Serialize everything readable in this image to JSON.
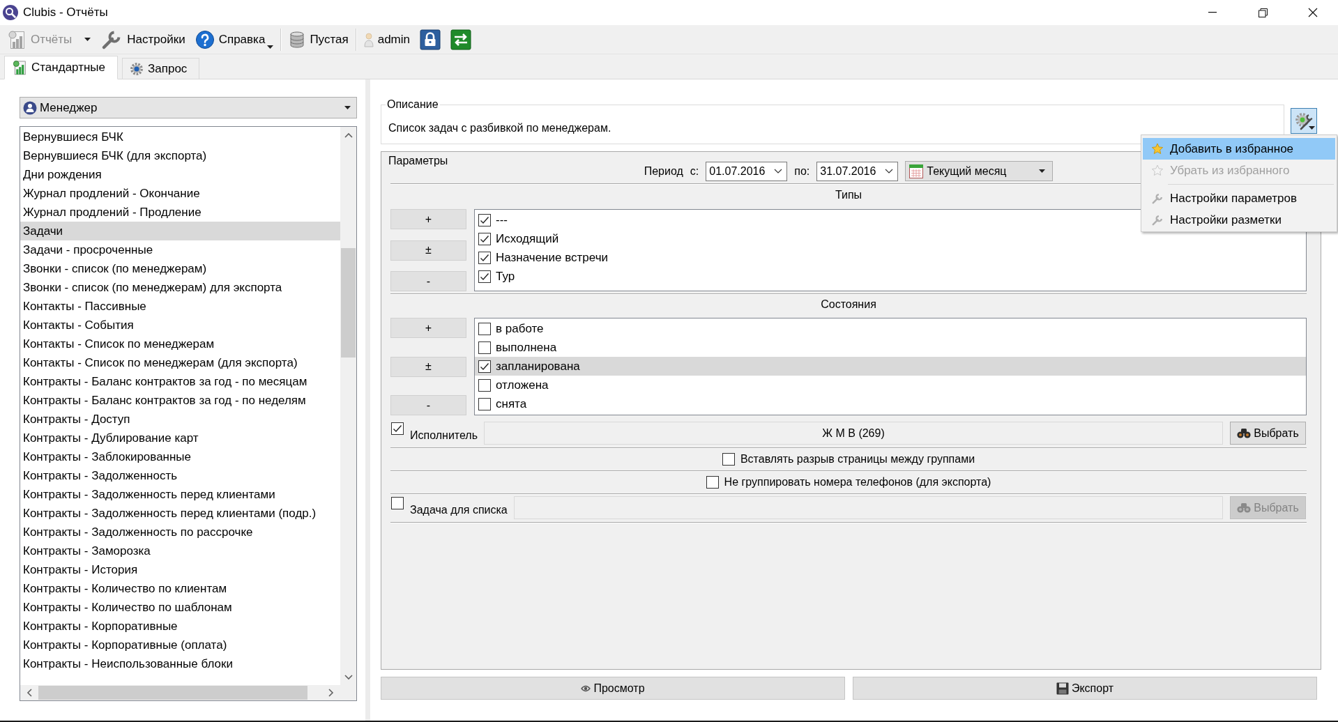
{
  "window": {
    "title": "Clubis - Отчёты"
  },
  "toolbar": {
    "groups": [
      [
        {
          "kind": "reports",
          "label": "Отчёты",
          "disabled": true,
          "split": true,
          "menu": false
        },
        {
          "kind": "wrench",
          "label": "Настройки",
          "disabled": false,
          "split": false,
          "menu": false
        },
        {
          "kind": "help",
          "label": "Справка",
          "disabled": false,
          "split": false,
          "menu": true
        }
      ],
      [
        {
          "kind": "database",
          "label": "Пустая",
          "disabled": false,
          "split": false,
          "menu": false
        }
      ],
      [
        {
          "kind": "user",
          "label": "admin",
          "disabled": false,
          "split": false,
          "menu": false
        },
        {
          "kind": "lock",
          "disabled": false,
          "split": false,
          "menu": false
        },
        {
          "kind": "exchange",
          "disabled": false,
          "split": false,
          "menu": false
        }
      ]
    ]
  },
  "tabs": [
    {
      "kind": "chart",
      "label": "Стандартные",
      "selected": true
    },
    {
      "kind": "gear",
      "label": "Запрос",
      "selected": false
    }
  ],
  "report_group": {
    "value": "Менеджер"
  },
  "reports": [
    {
      "label": "Вернувшиеся БЧК",
      "selected": false
    },
    {
      "label": "Вернувшиеся БЧК (для экспорта)",
      "selected": false
    },
    {
      "label": "Дни рождения",
      "selected": false
    },
    {
      "label": "Журнал продлений - Окончание",
      "selected": false
    },
    {
      "label": "Журнал продлений - Продление",
      "selected": false
    },
    {
      "label": "Задачи",
      "selected": true
    },
    {
      "label": "Задачи - просроченные",
      "selected": false
    },
    {
      "label": "Звонки - список (по менеджерам)",
      "selected": false
    },
    {
      "label": "Звонки - список (по менеджерам) для экспорта",
      "selected": false
    },
    {
      "label": "Контакты - Пассивные",
      "selected": false
    },
    {
      "label": "Контакты - События",
      "selected": false
    },
    {
      "label": "Контакты - Список по менеджерам",
      "selected": false
    },
    {
      "label": "Контакты - Список по менеджерам (для экспорта)",
      "selected": false
    },
    {
      "label": "Контракты - Баланс контрактов за год - по месяцам",
      "selected": false
    },
    {
      "label": "Контракты - Баланс контрактов за год - по неделям",
      "selected": false
    },
    {
      "label": "Контракты - Доступ",
      "selected": false
    },
    {
      "label": "Контракты - Дублирование карт",
      "selected": false
    },
    {
      "label": "Контракты - Заблокированные",
      "selected": false
    },
    {
      "label": "Контракты - Задолженность",
      "selected": false
    },
    {
      "label": "Контракты - Задолженность перед клиентами",
      "selected": false
    },
    {
      "label": "Контракты - Задолженность перед клиентами (подр.)",
      "selected": false
    },
    {
      "label": "Контракты - Задолженность по рассрочке",
      "selected": false
    },
    {
      "label": "Контракты - Заморозка",
      "selected": false
    },
    {
      "label": "Контракты - История",
      "selected": false
    },
    {
      "label": "Контракты - Количество по клиентам",
      "selected": false
    },
    {
      "label": "Контракты - Количество по шаблонам",
      "selected": false
    },
    {
      "label": "Контракты - Корпоративные",
      "selected": false
    },
    {
      "label": "Контракты - Корпоративные (оплата)",
      "selected": false
    },
    {
      "label": "Контракты - Неиспользованные блоки",
      "selected": false
    }
  ],
  "description": {
    "title": "Описание",
    "text": "Список задач с разбивкой по менеджерам."
  },
  "parameters": {
    "title": "Параметры",
    "period": {
      "label": "Период",
      "from_label": "с:",
      "from": "01.07.2016",
      "to_label": "по:",
      "to": "31.07.2016",
      "preset": "Текущий месяц"
    },
    "lists": [
      {
        "title": "Типы",
        "buttons": [
          "+",
          "±",
          "-"
        ],
        "items": [
          {
            "label": "---",
            "checked": true,
            "selected": false
          },
          {
            "label": "Исходящий",
            "checked": true,
            "selected": false
          },
          {
            "label": "Назначение встречи",
            "checked": true,
            "selected": false
          },
          {
            "label": "Тур",
            "checked": true,
            "selected": false
          }
        ]
      },
      {
        "title": "Состояния",
        "buttons": [
          "+",
          "±",
          "-"
        ],
        "items": [
          {
            "label": "в работе",
            "checked": false,
            "selected": false
          },
          {
            "label": "выполнена",
            "checked": false,
            "selected": false
          },
          {
            "label": "запланирована",
            "checked": true,
            "selected": true
          },
          {
            "label": "отложена",
            "checked": false,
            "selected": false
          },
          {
            "label": "снята",
            "checked": false,
            "selected": false
          }
        ]
      }
    ],
    "rows": [
      {
        "kind": "picker",
        "checked": true,
        "label": "Исполнитель",
        "value": "Ж М В (269)",
        "button": "Выбрать",
        "disabled": false
      },
      {
        "kind": "option",
        "checked": false,
        "label": "Вставлять разрыв страницы между группами"
      },
      {
        "kind": "option",
        "checked": false,
        "label": "Не группировать номера телефонов (для экспорта)"
      },
      {
        "kind": "picker",
        "checked": false,
        "label": "Задача для списка",
        "button": "Выбрать",
        "disabled": true
      }
    ]
  },
  "actions": [
    {
      "kind": "preview",
      "label": "Просмотр"
    },
    {
      "kind": "export",
      "label": "Экспорт"
    }
  ],
  "context_menu": {
    "items": [
      {
        "kind": "star",
        "label": "Добавить в избранное",
        "selected": true,
        "disabled": false
      },
      {
        "kind": "star",
        "label": "Убрать из избранного",
        "selected": false,
        "disabled": true
      },
      {
        "kind": "separator"
      },
      {
        "kind": "wrench",
        "label": "Настройки параметров",
        "selected": false,
        "disabled": false
      },
      {
        "kind": "wrench",
        "label": "Настройки разметки",
        "selected": false,
        "disabled": false
      }
    ]
  }
}
